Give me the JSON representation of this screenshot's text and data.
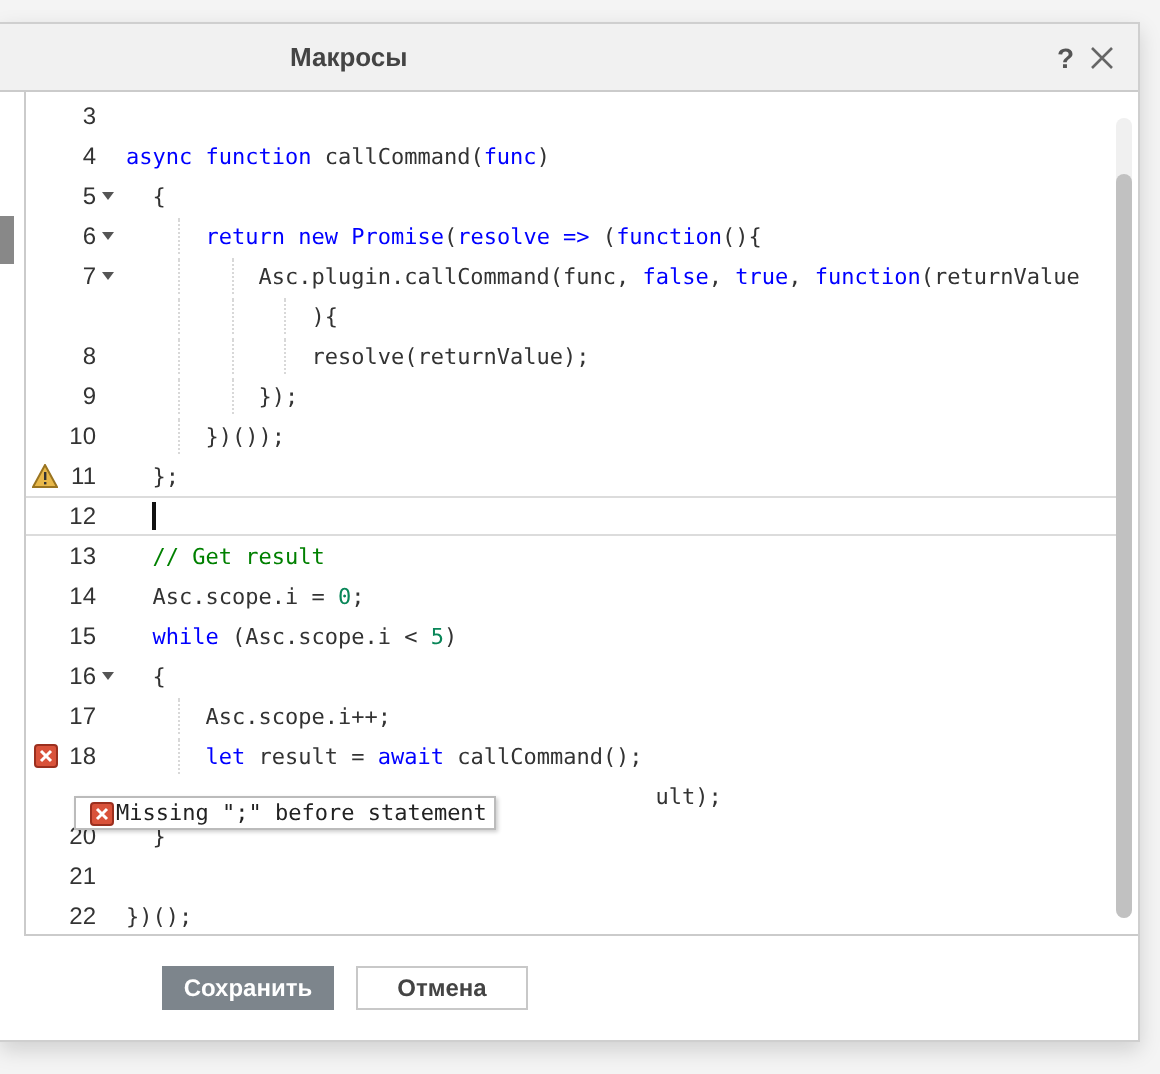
{
  "dialog": {
    "title": "Макросы",
    "help": "?"
  },
  "editor": {
    "lines": [
      {
        "number": "3"
      },
      {
        "number": "4",
        "tokens": [
          {
            "t": "async function",
            "kind": "kw"
          },
          {
            "t": " callCommand(",
            "kind": "plain"
          },
          {
            "t": "func",
            "kind": "kw"
          },
          {
            "t": ")",
            "kind": "plain"
          }
        ]
      },
      {
        "number": "5",
        "fold": true,
        "tokens": [
          {
            "t": "  {",
            "kind": "plain"
          }
        ]
      },
      {
        "number": "6",
        "fold": true,
        "tokens": [
          {
            "t": "      return new Promise",
            "kind": "kw"
          },
          {
            "t": "(",
            "kind": "plain"
          },
          {
            "t": "resolve =>",
            "kind": "kw"
          },
          {
            "t": " (",
            "kind": "plain"
          },
          {
            "t": "function",
            "kind": "kw"
          },
          {
            "t": "(){",
            "kind": "plain"
          }
        ]
      },
      {
        "number": "7",
        "fold": true,
        "tokens": [
          {
            "t": "          Asc.plugin.callCommand(func, ",
            "kind": "plain"
          },
          {
            "t": "false",
            "kind": "kw"
          },
          {
            "t": ", ",
            "kind": "plain"
          },
          {
            "t": "true",
            "kind": "kw"
          },
          {
            "t": ", ",
            "kind": "plain"
          },
          {
            "t": "function",
            "kind": "kw"
          },
          {
            "t": "(returnValue",
            "kind": "plain"
          }
        ]
      },
      {
        "tokens": [
          {
            "t": "              ){",
            "kind": "plain"
          }
        ]
      },
      {
        "number": "8",
        "tokens": [
          {
            "t": "              resolve(returnValue);",
            "kind": "plain"
          }
        ]
      },
      {
        "number": "9",
        "tokens": [
          {
            "t": "          });",
            "kind": "plain"
          }
        ]
      },
      {
        "number": "10",
        "tokens": [
          {
            "t": "      })());",
            "kind": "plain"
          }
        ]
      },
      {
        "number": "11",
        "warning": true,
        "tokens": [
          {
            "t": "  };",
            "kind": "plain"
          }
        ]
      },
      {
        "number": "12",
        "current": true
      },
      {
        "number": "13",
        "tokens": [
          {
            "t": "  // Get result",
            "kind": "comment"
          }
        ]
      },
      {
        "number": "14",
        "tokens": [
          {
            "t": "  Asc.scope.i = ",
            "kind": "plain"
          },
          {
            "t": "0",
            "kind": "num"
          },
          {
            "t": ";",
            "kind": "plain"
          }
        ]
      },
      {
        "number": "15",
        "tokens": [
          {
            "t": "  while",
            "kind": "kw"
          },
          {
            "t": " (Asc.scope.i < ",
            "kind": "plain"
          },
          {
            "t": "5",
            "kind": "num"
          },
          {
            "t": ")",
            "kind": "plain"
          }
        ]
      },
      {
        "number": "16",
        "fold": true,
        "tokens": [
          {
            "t": "  {",
            "kind": "plain"
          }
        ]
      },
      {
        "number": "17",
        "tokens": [
          {
            "t": "      Asc.scope.i++;",
            "kind": "plain"
          }
        ]
      },
      {
        "number": "18",
        "error": true,
        "tokens": [
          {
            "t": "      let",
            "kind": "kw"
          },
          {
            "t": " result = ",
            "kind": "plain"
          },
          {
            "t": "await",
            "kind": "kw"
          },
          {
            "t": " callCommand();",
            "kind": "plain"
          }
        ]
      },
      {
        "covered": true,
        "tokens": [
          {
            "t": "ult);",
            "kind": "plain"
          }
        ]
      },
      {
        "number": "20",
        "tokens": [
          {
            "t": "  }",
            "kind": "plain"
          }
        ]
      },
      {
        "number": "21"
      },
      {
        "number": "22",
        "tokens": [
          {
            "t": "})();",
            "kind": "plain"
          }
        ]
      }
    ],
    "tooltip": {
      "kind": "error",
      "text": "Missing \";\" before statement"
    }
  },
  "buttons": [
    {
      "label": "Сохранить",
      "primary": true
    },
    {
      "label": "Отмена",
      "primary": false
    }
  ]
}
